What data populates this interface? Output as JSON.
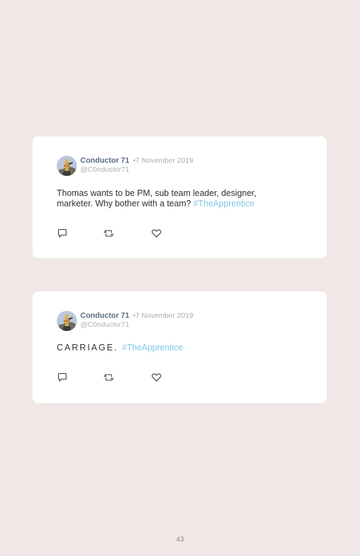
{
  "tweets": [
    {
      "author_name": "Conductor 71",
      "date": "•7 November 2019",
      "handle": "@C0nductor71",
      "text": "Thomas wants to be PM, sub team leader, designer, marketer. Why bother with a team? ",
      "hashtag": "#TheApprentice"
    },
    {
      "author_name": "Conductor 71",
      "date": "•7 November 2019",
      "handle": "@C0nductor71",
      "text": "CARRIAGE. ",
      "hashtag": "#TheApprentice"
    }
  ],
  "icons": {
    "avatar": "avatar-image",
    "reply": "reply-icon",
    "retweet": "retweet-icon",
    "like": "heart-icon"
  },
  "colors": {
    "background": "#f1e7e6",
    "card": "#ffffff",
    "author_name": "#5b6b80",
    "meta": "#a8aeb6",
    "text": "#2a2f36",
    "hashtag": "#7ec8e3"
  },
  "page": {
    "number": "43"
  }
}
